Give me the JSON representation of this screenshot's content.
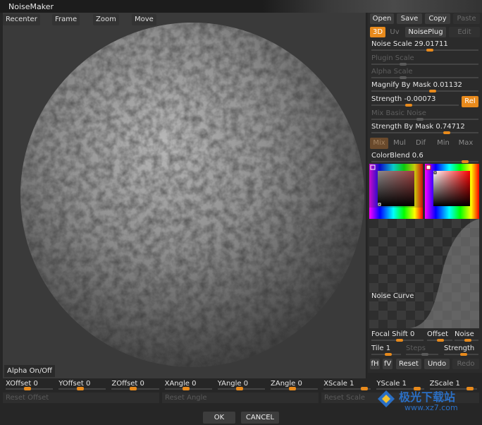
{
  "window": {
    "title": "NoiseMaker"
  },
  "viewport": {
    "buttons": [
      "Recenter",
      "Frame",
      "Zoom",
      "Move"
    ],
    "alpha_toggle": "Alpha On/Off"
  },
  "panel": {
    "file_buttons": [
      {
        "label": "Open",
        "enabled": true
      },
      {
        "label": "Save",
        "enabled": true
      },
      {
        "label": "Copy",
        "enabled": true
      },
      {
        "label": "Paste",
        "enabled": false
      }
    ],
    "mode_buttons": [
      {
        "label": "3D",
        "active": true
      },
      {
        "label": "Uv",
        "active": false
      },
      {
        "label": "NoisePlug",
        "active": false,
        "enabled": true
      },
      {
        "label": "Edit",
        "enabled": false
      }
    ],
    "sliders": [
      {
        "label": "Noise Scale",
        "value": "29.01711",
        "fraction": 0.55,
        "enabled": true
      },
      {
        "label": "Plugin Scale",
        "value": "",
        "fraction": 0.28,
        "enabled": false
      },
      {
        "label": "Alpha Scale",
        "value": "",
        "fraction": 0.28,
        "enabled": false
      },
      {
        "label": "Magnify By Mask",
        "value": "0.01132",
        "fraction": 0.58,
        "enabled": true
      },
      {
        "label": "Strength",
        "value": "-0.00073",
        "fraction": 0.42,
        "enabled": true
      },
      {
        "label": "Mix Basic Noise",
        "value": "",
        "fraction": 0.45,
        "enabled": false
      },
      {
        "label": "Strength By Mask",
        "value": "0.74712",
        "fraction": 0.72,
        "enabled": true
      }
    ],
    "rel_button": "Rel",
    "blend_modes": [
      {
        "label": "Mix",
        "selected": true
      },
      {
        "label": "Mul",
        "selected": false
      },
      {
        "label": "Dif",
        "selected": false
      },
      {
        "label": "Min",
        "selected": false
      },
      {
        "label": "Max",
        "selected": false
      }
    ],
    "color_blend": {
      "label": "ColorBlend",
      "value": "0.6",
      "fraction": 0.9
    },
    "noise_curve_label": "Noise Curve",
    "focal": [
      {
        "label": "Focal Shift",
        "value": "0",
        "fraction": 0.55
      },
      {
        "label": "Offset",
        "value": "",
        "fraction": 0.55
      },
      {
        "label": "Noise",
        "value": "",
        "fraction": 0.6
      }
    ],
    "tile": [
      {
        "label": "Tile",
        "value": "1",
        "fraction": 0.6,
        "enabled": true
      },
      {
        "label": "Steps",
        "value": "",
        "fraction": 0.6,
        "enabled": false
      },
      {
        "label": "Strength",
        "value": "",
        "fraction": 0.6,
        "enabled": true
      }
    ],
    "curve_buttons": [
      {
        "label": "fH",
        "enabled": true
      },
      {
        "label": "fV",
        "enabled": true
      },
      {
        "label": "Reset",
        "enabled": true
      },
      {
        "label": "Undo",
        "enabled": true
      },
      {
        "label": "Redo",
        "enabled": false
      }
    ]
  },
  "bottom": {
    "sliders": [
      {
        "label": "XOffset",
        "value": "0",
        "fraction": 0.45
      },
      {
        "label": "YOffset",
        "value": "0",
        "fraction": 0.45
      },
      {
        "label": "ZOffset",
        "value": "0",
        "fraction": 0.45
      },
      {
        "label": "XAngle",
        "value": "0",
        "fraction": 0.45
      },
      {
        "label": "YAngle",
        "value": "0",
        "fraction": 0.45
      },
      {
        "label": "ZAngle",
        "value": "0",
        "fraction": 0.45
      },
      {
        "label": "XScale",
        "value": "1",
        "fraction": 0.92
      },
      {
        "label": "YScale",
        "value": "1",
        "fraction": 0.92
      },
      {
        "label": "ZScale",
        "value": "1",
        "fraction": 0.92
      }
    ],
    "reset_buttons": [
      "Reset Offset",
      "Reset Angle",
      "Reset Scale"
    ],
    "ok": "OK",
    "cancel": "CANCEL"
  },
  "watermark": {
    "title": "极光下载站",
    "url": "www.xz7.com"
  },
  "colors": {
    "accent": "#e88a1c",
    "panel": "#2b2b2b",
    "viewport": "#3a3a3a"
  }
}
